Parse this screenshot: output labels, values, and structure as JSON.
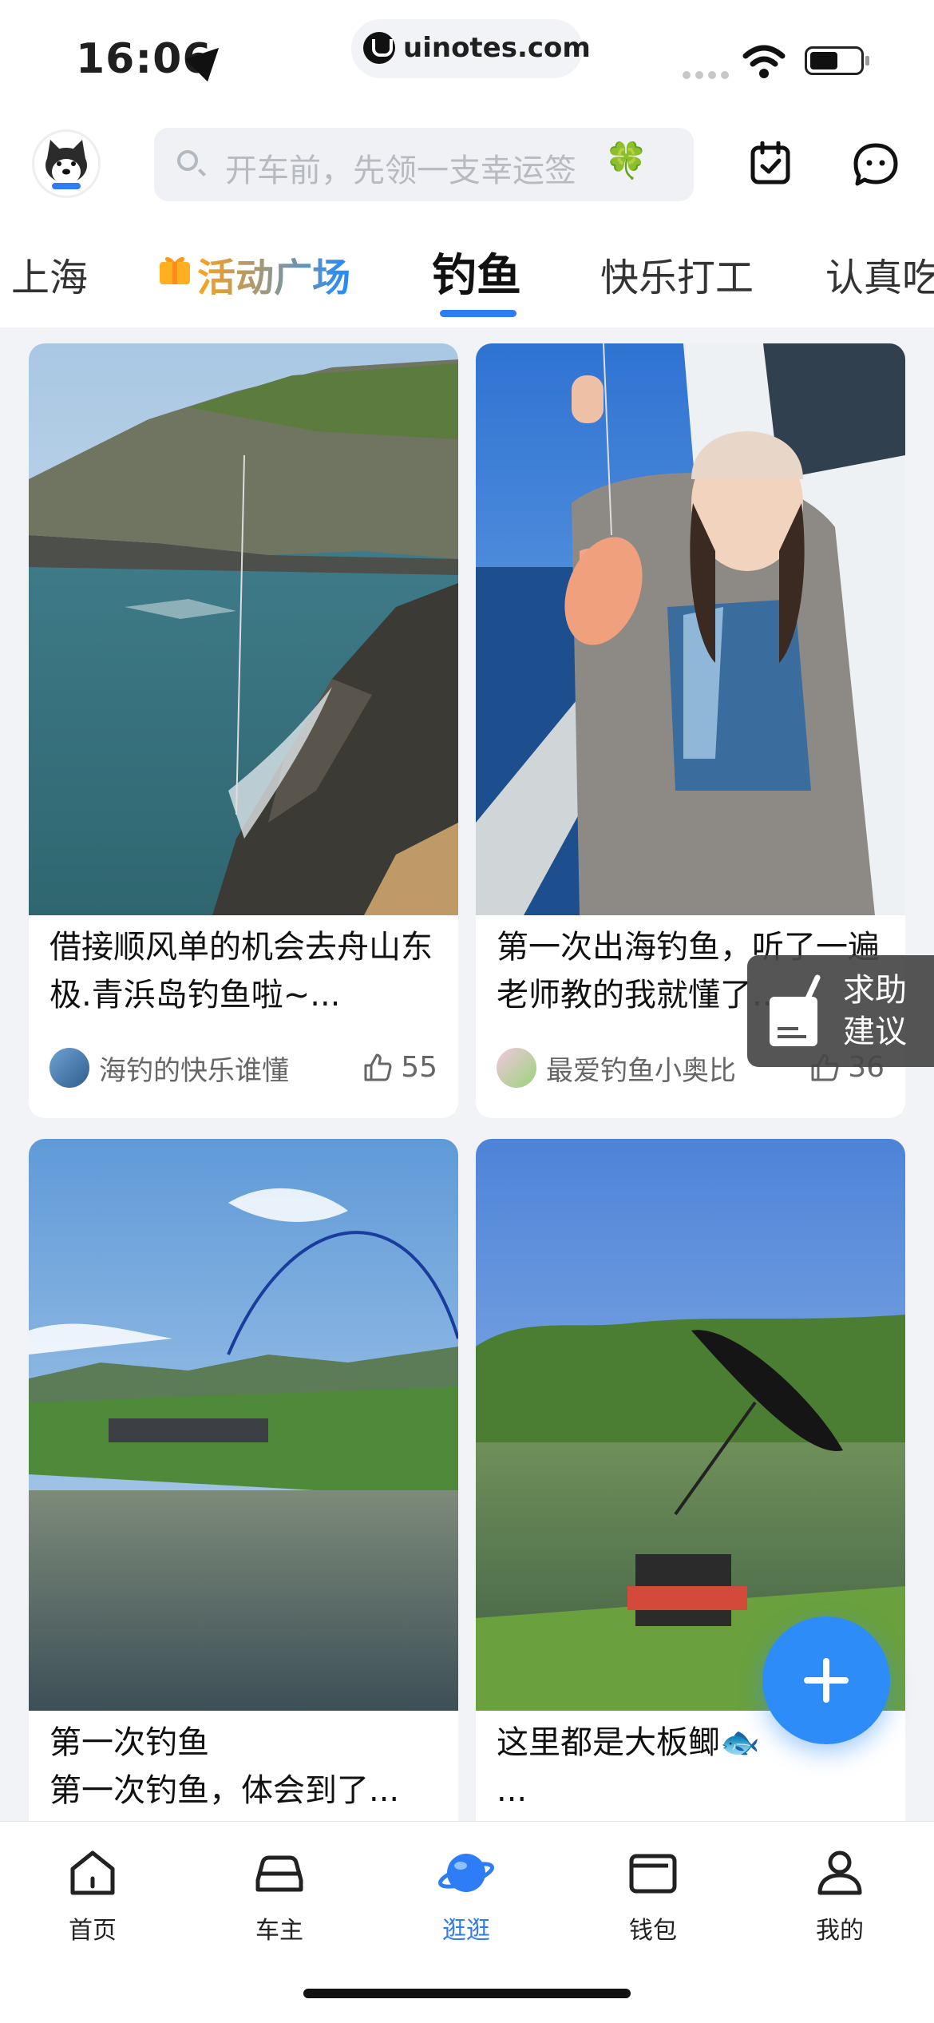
{
  "status_bar": {
    "time": "16:06",
    "url": "uinotes.com"
  },
  "header": {
    "search_placeholder": "开车前，先领一支幸运签",
    "search_emoji": "🍀"
  },
  "tabs": [
    {
      "label": "上海"
    },
    {
      "label": "活动广场"
    },
    {
      "label": "钓鱼",
      "active": true
    },
    {
      "label": "快乐打工"
    },
    {
      "label": "认真吃"
    }
  ],
  "feed": [
    {
      "title": "借接顺风单的机会去舟山东极.青浜岛钓鱼啦~...",
      "author": "海钓的快乐谁懂",
      "likes": "55"
    },
    {
      "title": "第一次出海钓鱼，听了一遍老师教的我就懂了...",
      "author": "最爱钓鱼小奥比",
      "likes": "36"
    },
    {
      "title": "第一次钓鱼\n第一次钓鱼，体会到了...",
      "author": "",
      "likes": ""
    },
    {
      "title": "这里都是大板鲫🐟\n...",
      "author": "",
      "likes": ""
    }
  ],
  "help_float": {
    "label": "求助\n建议"
  },
  "bottom_nav": [
    {
      "label": "首页"
    },
    {
      "label": "车主"
    },
    {
      "label": "逛逛",
      "active": true
    },
    {
      "label": "钱包"
    },
    {
      "label": "我的"
    }
  ],
  "colors": {
    "accent": "#2e7cf6",
    "fab": "#2e8cf8",
    "background": "#f2f3f6"
  }
}
